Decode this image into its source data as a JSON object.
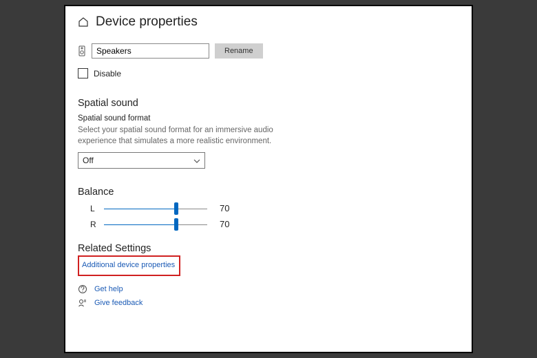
{
  "page": {
    "title": "Device properties"
  },
  "device": {
    "name": "Speakers",
    "rename_label": "Rename",
    "disable_label": "Disable"
  },
  "spatial": {
    "heading": "Spatial sound",
    "sub_label": "Spatial sound format",
    "description": "Select your spatial sound format for an immersive audio experience that simulates a more realistic environment.",
    "selected": "Off"
  },
  "balance": {
    "heading": "Balance",
    "left_label": "L",
    "left_value": "70",
    "right_label": "R",
    "right_value": "70"
  },
  "related": {
    "heading": "Related Settings",
    "additional_link": "Additional device properties"
  },
  "help": {
    "get_help": "Get help",
    "give_feedback": "Give feedback"
  }
}
